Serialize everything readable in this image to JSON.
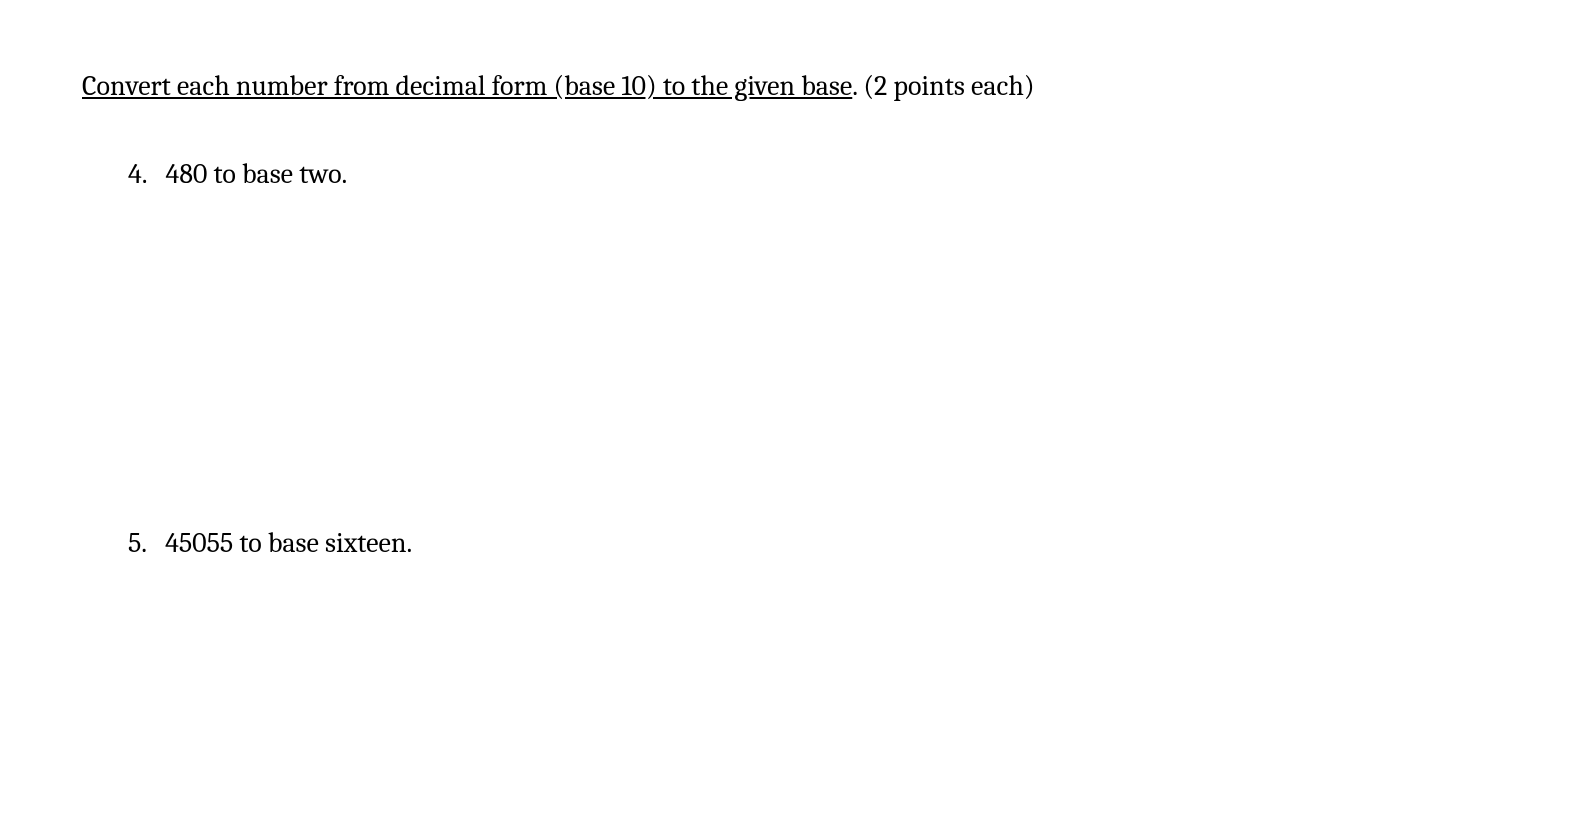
{
  "instruction": {
    "underlined_text": "Convert each number from decimal form (base 10) to the given base",
    "trailing_text": ".  (2 points each)"
  },
  "questions": [
    {
      "number": "4.",
      "text": "480 to base two."
    },
    {
      "number": "5.",
      "text": "45055 to base sixteen."
    }
  ]
}
